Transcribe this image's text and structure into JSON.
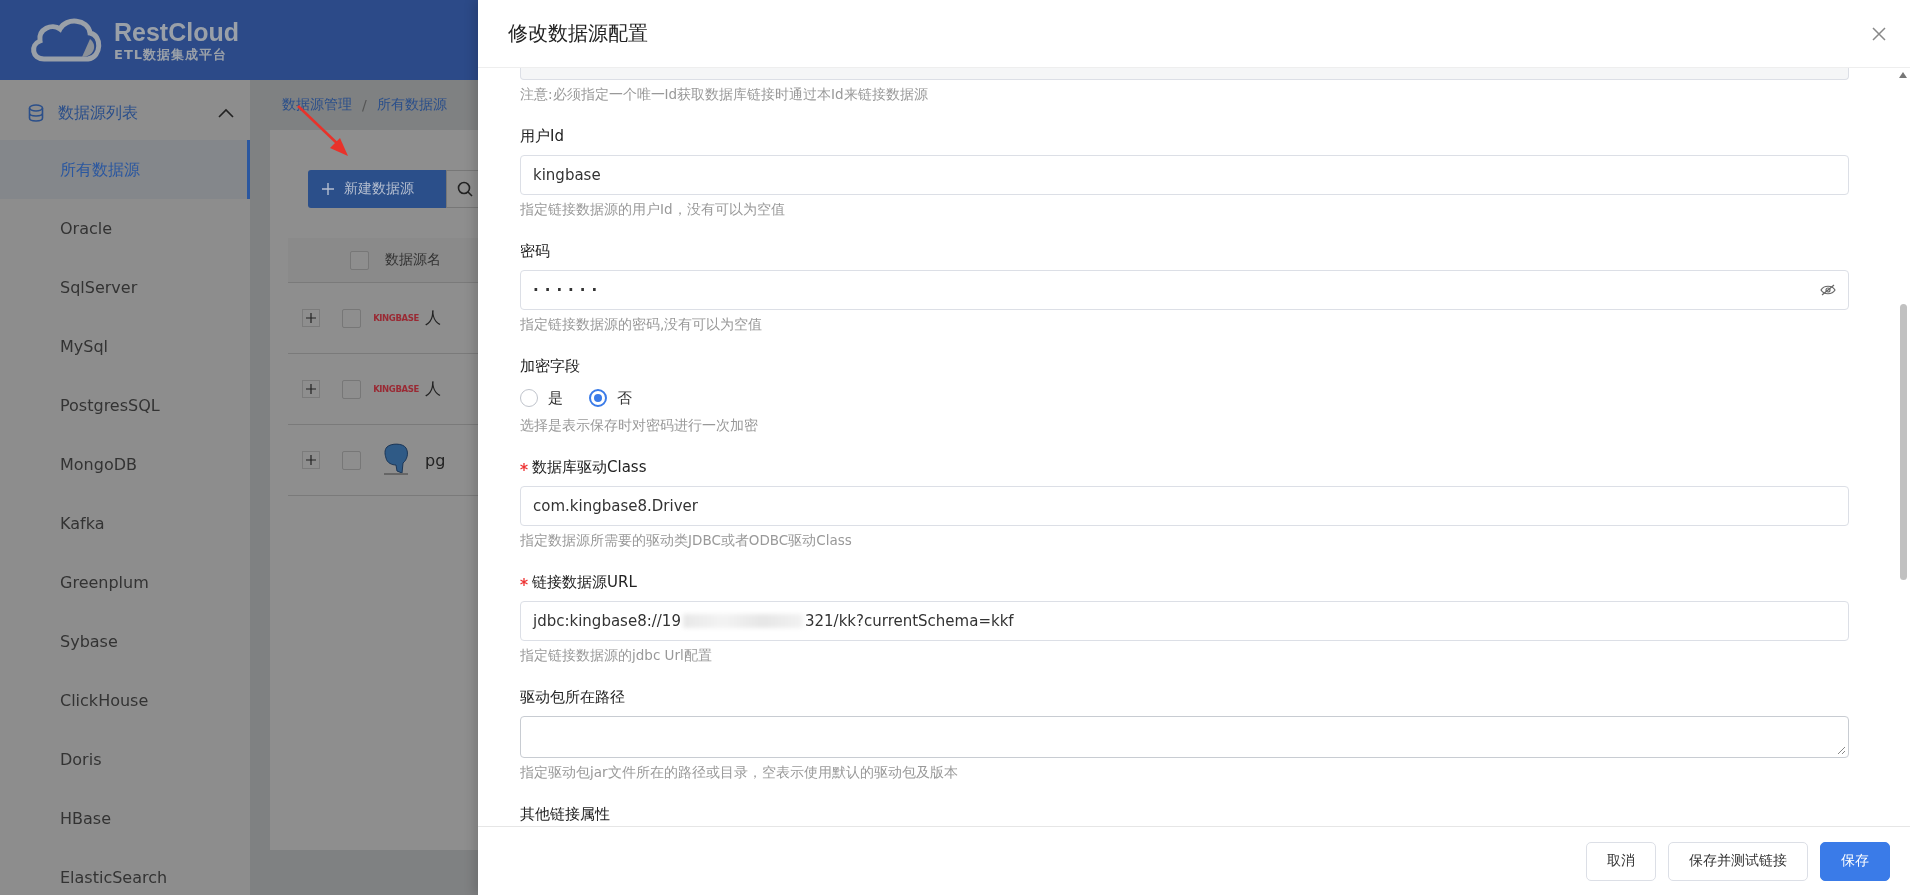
{
  "app": {
    "logo_title": "RestCloud",
    "logo_subtitle": "ETL数据集成平台"
  },
  "sidebar": {
    "group": {
      "label": "数据源列表",
      "expanded": true
    },
    "items": [
      {
        "label": "所有数据源",
        "selected": true
      },
      {
        "label": "Oracle",
        "selected": false
      },
      {
        "label": "SqlServer",
        "selected": false
      },
      {
        "label": "MySql",
        "selected": false
      },
      {
        "label": "PostgresSQL",
        "selected": false
      },
      {
        "label": "MongoDB",
        "selected": false
      },
      {
        "label": "Kafka",
        "selected": false
      },
      {
        "label": "Greenplum",
        "selected": false
      },
      {
        "label": "Sybase",
        "selected": false
      },
      {
        "label": "ClickHouse",
        "selected": false
      },
      {
        "label": "Doris",
        "selected": false
      },
      {
        "label": "HBase",
        "selected": false
      },
      {
        "label": "ElasticSearch",
        "selected": false
      }
    ]
  },
  "breadcrumb": {
    "separator": "/",
    "items": [
      "数据源管理",
      "所有数据源"
    ]
  },
  "toolbar": {
    "new_button": "新建数据源"
  },
  "table": {
    "columns": [
      "数据源名"
    ],
    "header_checked": false,
    "rows": [
      {
        "kind": "kingbase",
        "logo_text": "KINGBASE",
        "name": "人",
        "checked": false
      },
      {
        "kind": "kingbase",
        "logo_text": "KINGBASE",
        "name": "人",
        "checked": false
      },
      {
        "kind": "postgresql",
        "name": "pg",
        "checked": false
      }
    ]
  },
  "drawer": {
    "title": "修改数据源配置",
    "fields": [
      {
        "kind": "cut_input",
        "hint": "注意:必须指定一个唯一Id获取数据库链接时通过本Id来链接数据源"
      },
      {
        "kind": "input",
        "label": "用户Id",
        "required": false,
        "value": "kingbase",
        "hint": "指定链接数据源的用户Id，没有可以为空值"
      },
      {
        "kind": "password",
        "label": "密码",
        "required": false,
        "value": "······",
        "hint": "指定链接数据源的密码,没有可以为空值"
      },
      {
        "kind": "radio",
        "label": "加密字段",
        "required": false,
        "options": [
          {
            "label": "是",
            "selected": false
          },
          {
            "label": "否",
            "selected": true
          }
        ],
        "hint": "选择是表示保存时对密码进行一次加密"
      },
      {
        "kind": "input",
        "label": "数据库驱动Class",
        "required": true,
        "value": "com.kingbase8.Driver",
        "hint": "指定数据源所需要的驱动类JDBC或者ODBC驱动Class"
      },
      {
        "kind": "redacted_input",
        "label": "链接数据源URL",
        "required": true,
        "value_parts": [
          "jdbc:kingbase8://19",
          "321/kk?currentSchema=kkf"
        ],
        "hint": "指定链接数据源的jdbc Url配置"
      },
      {
        "kind": "textarea",
        "label": "驱动包所在路径",
        "required": false,
        "hint": "指定驱动包jar文件所在的路径或目录，空表示使用默认的驱动包及版本"
      },
      {
        "kind": "label_only",
        "label": "其他链接属性",
        "required": false
      }
    ],
    "buttons": [
      {
        "label": "取消",
        "kind": "default"
      },
      {
        "label": "保存并测试链接",
        "kind": "default"
      },
      {
        "label": "保存",
        "kind": "primary"
      }
    ]
  }
}
